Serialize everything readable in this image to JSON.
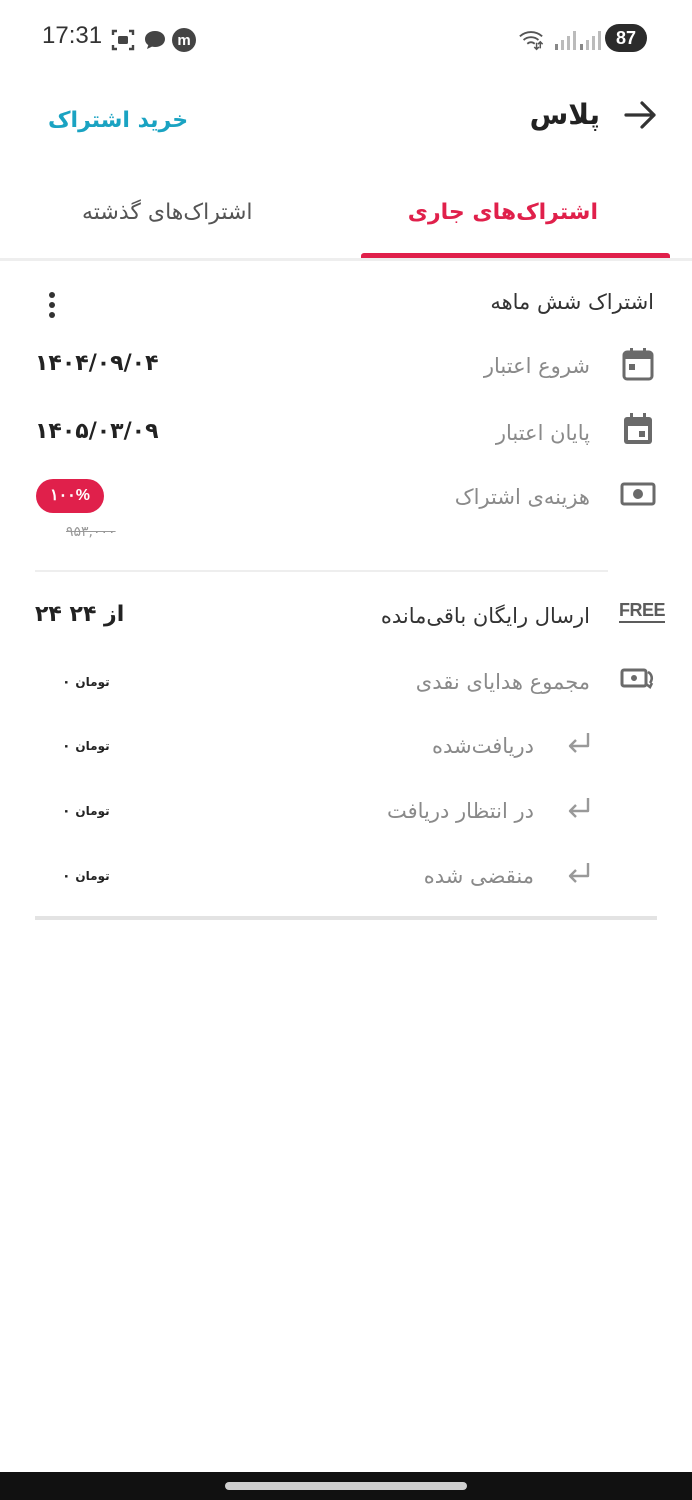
{
  "status_bar": {
    "time": "17:31",
    "battery": "87",
    "icons": [
      "screenshot-icon",
      "message-icon",
      "m-app-icon",
      "wifi-icon",
      "signal-icon",
      "signal-icon-2"
    ]
  },
  "header": {
    "title": "پلاس",
    "buy_link": "خرید اشتراک"
  },
  "tabs": [
    {
      "label": "اشتراک‌های جاری",
      "active": true
    },
    {
      "label": "اشتراک‌های گذشته",
      "active": false
    }
  ],
  "subscription": {
    "title": "اشتراک شش ماهه",
    "rows": [
      {
        "label": "شروع اعتبار",
        "value": "۱۴۰۴/۰۹/۰۴",
        "icon": "calendar-icon"
      },
      {
        "label": "پایان اعتبار",
        "value": "۱۴۰۵/۰۳/۰۹",
        "icon": "calendar-filled-icon"
      }
    ],
    "cost": {
      "label": "هزینه‌ی اشتراک",
      "discount_badge": "۱۰۰%",
      "original_price": "۹۵۳,۰۰۰",
      "icon": "cash-icon"
    }
  },
  "benefits": {
    "free_shipping": {
      "label": "ارسال رایگان باقی‌مانده",
      "value": "۲۴ از ۲۴",
      "icon_text": "FREE"
    },
    "cash_gifts": {
      "label": "مجموع هدایای نقدی",
      "value": "۰",
      "currency": "تومان",
      "icon": "cashback-icon"
    },
    "sub_items": [
      {
        "label": "دریافت‌شده",
        "value": "۰",
        "currency": "تومان"
      },
      {
        "label": "در انتظار دریافت",
        "value": "۰",
        "currency": "تومان"
      },
      {
        "label": "منقضی شده",
        "value": "۰",
        "currency": "تومان"
      }
    ]
  },
  "colors": {
    "accent": "#e0204b",
    "link": "#1aa3c2",
    "label": "#8a8a8a"
  }
}
